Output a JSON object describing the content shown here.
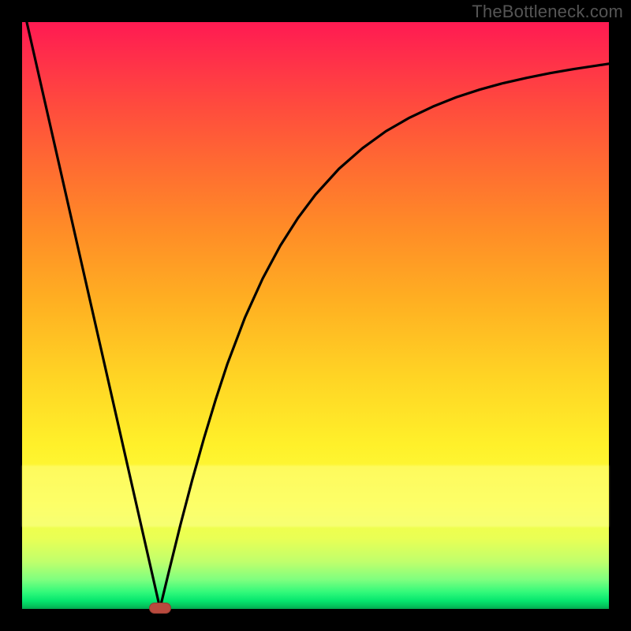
{
  "watermark": "TheBottleneck.com",
  "colors": {
    "curve": "#000000",
    "marker": "#b94a3e",
    "frame": "#000000"
  },
  "chart_data": {
    "type": "line",
    "title": "",
    "xlabel": "",
    "ylabel": "",
    "xlim": [
      0,
      100
    ],
    "ylim": [
      0,
      100
    ],
    "grid": false,
    "x": [
      0,
      2,
      4,
      6,
      8,
      10,
      12,
      14,
      16,
      18,
      20,
      22,
      23.5,
      25,
      27,
      29,
      31,
      33,
      35,
      38,
      41,
      44,
      47,
      50,
      54,
      58,
      62,
      66,
      70,
      74,
      78,
      82,
      86,
      90,
      94,
      98,
      100
    ],
    "values": [
      103.5,
      94.7,
      85.9,
      77.1,
      68.3,
      59.5,
      50.7,
      41.9,
      33.1,
      24.3,
      15.5,
      6.7,
      0.1,
      6.3,
      14.4,
      22.0,
      29.1,
      35.7,
      41.8,
      49.7,
      56.3,
      61.9,
      66.6,
      70.6,
      75.0,
      78.5,
      81.4,
      83.7,
      85.6,
      87.2,
      88.5,
      89.6,
      90.5,
      91.3,
      92.0,
      92.6,
      92.9
    ],
    "min_marker": {
      "x": 23.5,
      "y": 0.1
    },
    "annotations": []
  }
}
